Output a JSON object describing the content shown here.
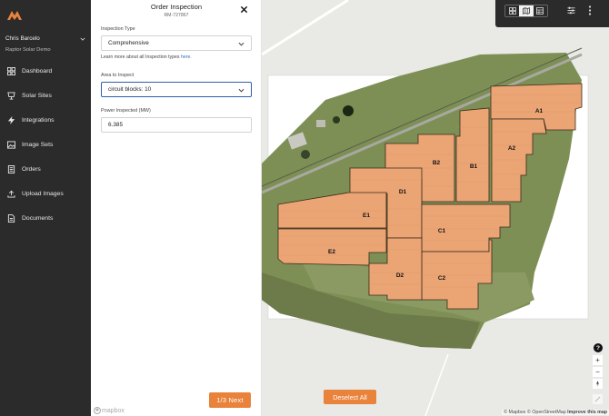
{
  "user": {
    "name": "Chris Barcelo",
    "org": "Raptor Solar Demo"
  },
  "nav": [
    {
      "label": "Dashboard",
      "icon": "dashboard-icon"
    },
    {
      "label": "Solar Sites",
      "icon": "solar-panel-icon"
    },
    {
      "label": "Integrations",
      "icon": "lightning-icon"
    },
    {
      "label": "Image Sets",
      "icon": "image-icon"
    },
    {
      "label": "Orders",
      "icon": "document-list-icon"
    },
    {
      "label": "Upload Images",
      "icon": "upload-icon"
    },
    {
      "label": "Documents",
      "icon": "document-icon"
    }
  ],
  "panel": {
    "title": "Order Inspection",
    "order_id": "RM-727867",
    "inspection_type_label": "Inspection Type",
    "inspection_type_value": "Comprehensive",
    "help_prefix": "Learn more about all Inspection types",
    "help_link": "here.",
    "area_label": "Area to Inspect",
    "area_value": "circuit blocks: 10",
    "power_label": "Power Inspected (MW)",
    "power_value": "6.385",
    "next_label": "1/3 Next",
    "mapbox_logo": "mapbox"
  },
  "map": {
    "deselect_label": "Deselect All",
    "blocks": [
      "A1",
      "A2",
      "B1",
      "B2",
      "C1",
      "C2",
      "D1",
      "D2",
      "E1",
      "E2"
    ],
    "help": "?",
    "zoom_in": "+",
    "zoom_out": "−",
    "attribution_prefix": "© Mapbox © OpenStreetMap",
    "attribution_link": "Improve this map",
    "block_color": "#eba575",
    "accent": "#e9823b"
  }
}
